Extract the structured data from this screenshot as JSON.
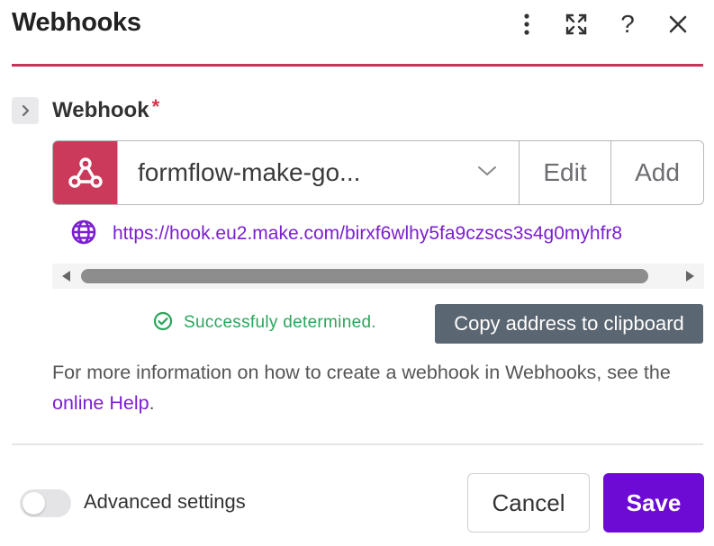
{
  "header": {
    "title": "Webhooks",
    "icons": [
      "more-vertical-icon",
      "maximize-icon",
      "help-icon",
      "close-icon"
    ],
    "help_glyph": "?",
    "accent_color": "#c9325a"
  },
  "field": {
    "label": "Webhook",
    "required_mark": "*"
  },
  "webhook": {
    "selected": "formflow-make-go...",
    "edit_label": "Edit",
    "add_label": "Add",
    "brand_color": "#cc3a5b",
    "url": "https://hook.eu2.make.com/birxf6wlhy5fa9czscs3s4g0myhfr8"
  },
  "status": {
    "text": "Successfuly determined.",
    "color": "#2aa65c"
  },
  "copy_button": {
    "label": "Copy address to clipboard"
  },
  "info": {
    "text_before": "For more information on how to create a webhook in Webhooks, see the ",
    "link_text": "online Help",
    "text_after": "."
  },
  "footer": {
    "advanced_label": "Advanced settings",
    "advanced_enabled": false,
    "cancel_label": "Cancel",
    "save_label": "Save",
    "save_color": "#6d0bd5"
  }
}
